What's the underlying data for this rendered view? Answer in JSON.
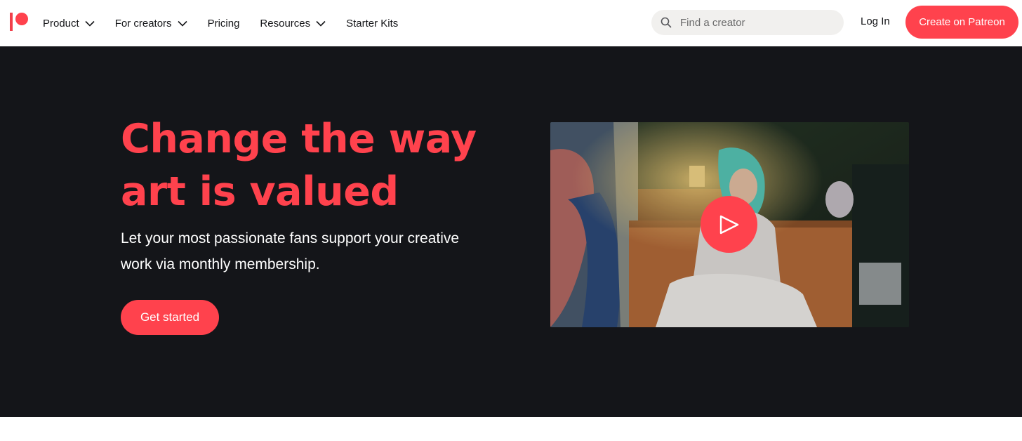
{
  "header": {
    "nav": [
      {
        "label": "Product",
        "has_dropdown": true
      },
      {
        "label": "For creators",
        "has_dropdown": true
      },
      {
        "label": "Pricing",
        "has_dropdown": false
      },
      {
        "label": "Resources",
        "has_dropdown": true
      },
      {
        "label": "Starter Kits",
        "has_dropdown": false
      }
    ],
    "search": {
      "placeholder": "Find a creator",
      "value": ""
    },
    "login_label": "Log In",
    "cta_label": "Create on Patreon"
  },
  "hero": {
    "headline_line1": "Change the way",
    "headline_line2": "art is valued",
    "subtext_line1": "Let your most passionate fans support your creative",
    "subtext_line2": "work via monthly membership.",
    "button_label": "Get started"
  },
  "icons": {
    "logo": "patreon-logo-icon",
    "search": "search-icon",
    "dropdown": "chevron-down-icon",
    "play": "play-icon"
  },
  "colors": {
    "brand": "#ff424d",
    "hero_background": "#141519",
    "search_background": "#f1f0ee"
  }
}
